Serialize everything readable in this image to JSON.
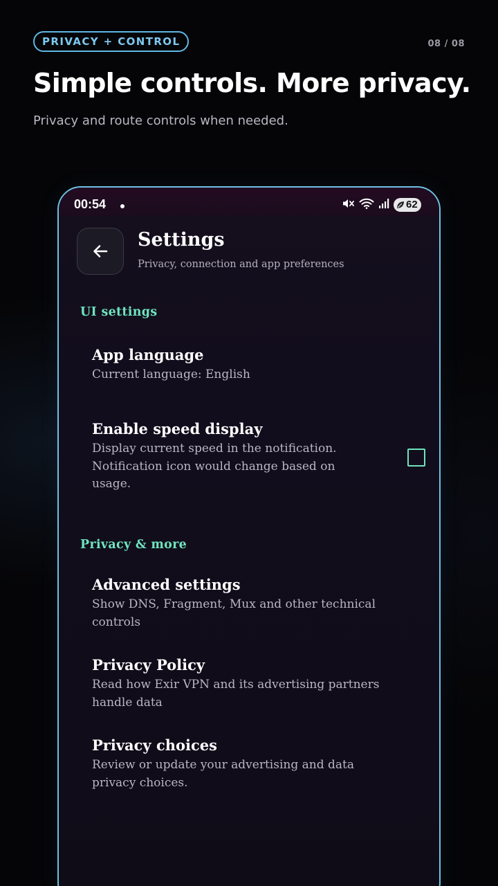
{
  "promo": {
    "badge": "PRIVACY + CONTROL",
    "counter": "08 / 08",
    "headline": "Simple controls. More privacy.",
    "subheadline": "Privacy and route controls when needed."
  },
  "status_bar": {
    "time": "00:54",
    "icons": [
      "mute-icon",
      "wifi-icon",
      "signal-icon"
    ],
    "battery": "62"
  },
  "header": {
    "back_icon": "arrow-left-icon",
    "title": "Settings",
    "subtitle": "Privacy, connection and app preferences"
  },
  "sections": [
    {
      "header": "UI settings",
      "items": [
        {
          "title": "App language",
          "description": "Current language: English"
        },
        {
          "title": "Enable speed display",
          "description": "Display current speed in the notification. Notification icon would change based on usage.",
          "checked": false
        }
      ]
    },
    {
      "header": "Privacy & more",
      "items": [
        {
          "title": "Advanced settings",
          "description": "Show DNS, Fragment, Mux and other technical controls"
        },
        {
          "title": "Privacy Policy",
          "description": "Read how Exir VPN and its advertising partners handle data"
        },
        {
          "title": "Privacy choices",
          "description": "Review or update your advertising and data privacy choices."
        }
      ]
    }
  ],
  "colors": {
    "accent": "#6fe3bf",
    "badge_border": "#5fb8e6",
    "phone_frame": "#6ec3e3",
    "background": "#050507"
  }
}
